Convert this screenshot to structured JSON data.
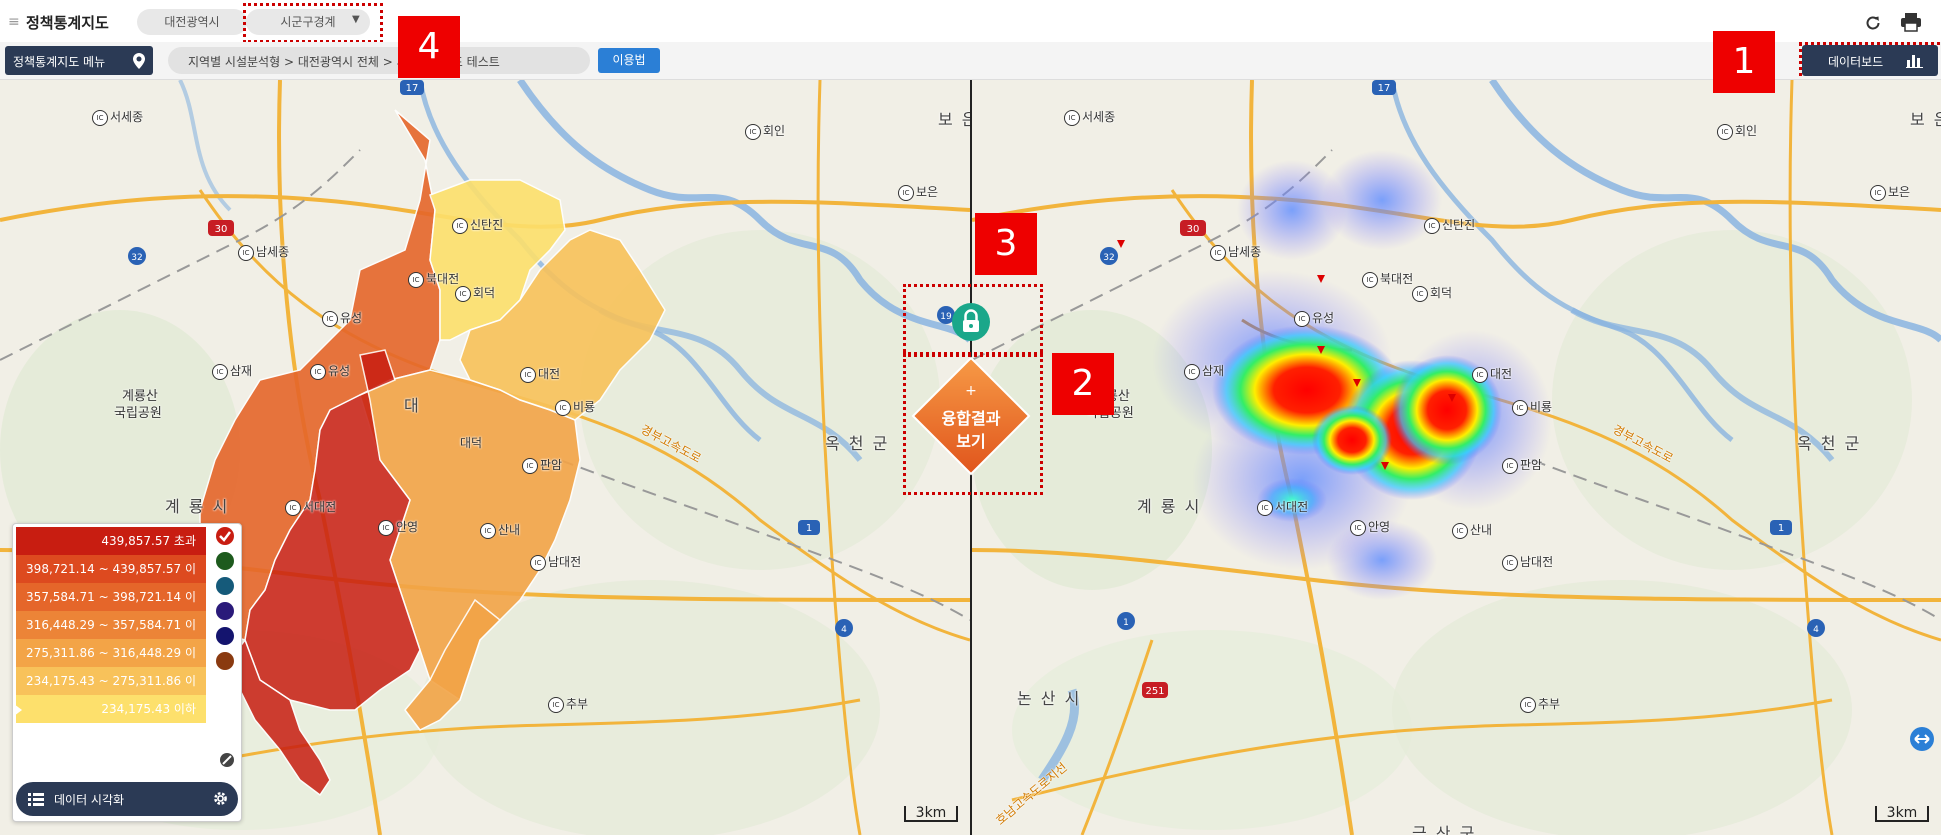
{
  "header": {
    "app_title": "정책통계지도",
    "region": "대전광역시",
    "boundary": "시군구경계",
    "menu_label": "정책통계지도 메뉴",
    "breadcrumb": "지역별 시설분석형 > 대전광역시 전체 > 시설분석지표 테스트",
    "help_label": "이용법",
    "dashboard_label": "데이터보드"
  },
  "icons": {
    "menu": "menu-icon",
    "refresh": "refresh-icon",
    "print": "print-icon",
    "pin": "pin-icon",
    "chart": "bar-chart-icon",
    "lock": "lock-icon",
    "gear": "gear-icon",
    "list": "list-icon",
    "no": "no-icon",
    "check": "check-icon",
    "expand": "expand-icon"
  },
  "overlay": {
    "fuse_plus": "+",
    "fuse_label_1": "융합결과",
    "fuse_label_2": "보기"
  },
  "badges": {
    "one": "1",
    "two": "2",
    "three": "3",
    "four": "4"
  },
  "legend": {
    "rows": [
      {
        "label": "439,857.57 초과",
        "color": "#c81d11"
      },
      {
        "label": "398,721.14 ~ 439,857.57 이하",
        "color": "#dd4a1f"
      },
      {
        "label": "357,584.71 ~ 398,721.14 이하",
        "color": "#e5662a"
      },
      {
        "label": "316,448.29 ~ 357,584.71 이하",
        "color": "#ec8437"
      },
      {
        "label": "275,311.86 ~ 316,448.29 이하",
        "color": "#f3a447"
      },
      {
        "label": "234,175.43 ~ 275,311.86 이하",
        "color": "#f8c25a"
      },
      {
        "label": "234,175.43 이하",
        "color": "#fde06c"
      }
    ],
    "palette_colors": [
      "#c81d11",
      "#1d5a1d",
      "#155a7a",
      "#2a1a7a",
      "#14146e",
      "#8a3a10"
    ],
    "viz_label": "데이터 시각화"
  },
  "map_left": {
    "scale_label": "3km",
    "places": {
      "seose": "서세종",
      "hoein": "회인",
      "bo": "보 은",
      "boeun": "보은",
      "sintanjin": "신탄진",
      "namsejong": "남세종",
      "bukdaejeon": "북대전",
      "hoedeok": "회덕",
      "yuseong": "유성",
      "yuseong2": "유성",
      "sapgyo": "삼재",
      "gyeryongsan": "계룡산",
      "gukrip": "국립공원",
      "daejeon": "대전",
      "dae": "대",
      "daedeok": "대덕",
      "birae": "비룡",
      "pangam": "판암",
      "okcheon": "옥 천 군",
      "gyeryong": "계 룡 시",
      "seodaejeon": "서대전",
      "anyeong": "안영",
      "sannae": "산내",
      "namdaejeon": "남대전",
      "chubu": "추부",
      "expressway": "경부고속도로"
    },
    "road_numbers": [
      "17",
      "30",
      "32",
      "1",
      "4",
      "19"
    ]
  },
  "map_right": {
    "scale_label": "3km",
    "places": {
      "seose": "서세종",
      "hoein": "회인",
      "bo": "보 은",
      "boeun": "보은",
      "sintanjin": "신탄진",
      "namsejong": "남세종",
      "bukdaejeon": "북대전",
      "hoedeok": "회덕",
      "yuseong": "유성",
      "sapgyo": "삼재",
      "gyeryongsan": "계룡산",
      "gukrip": "국립공원",
      "daejeon": "대전",
      "birae": "비룡",
      "pangam": "판암",
      "okcheon": "옥 천 군",
      "gyeryong": "계 룡 시",
      "seodaejeon": "서대전",
      "anyeong": "안영",
      "sannae": "산내",
      "namdaejeon": "남대전",
      "chubu": "추부",
      "nonsan": "논 산 시",
      "expressway": "경부고속도로",
      "honam": "호남고속도로지선",
      "geumsan": "금 산 군"
    },
    "road_numbers": [
      "17",
      "30",
      "32",
      "1",
      "4",
      "251"
    ]
  },
  "ic_label": "IC"
}
